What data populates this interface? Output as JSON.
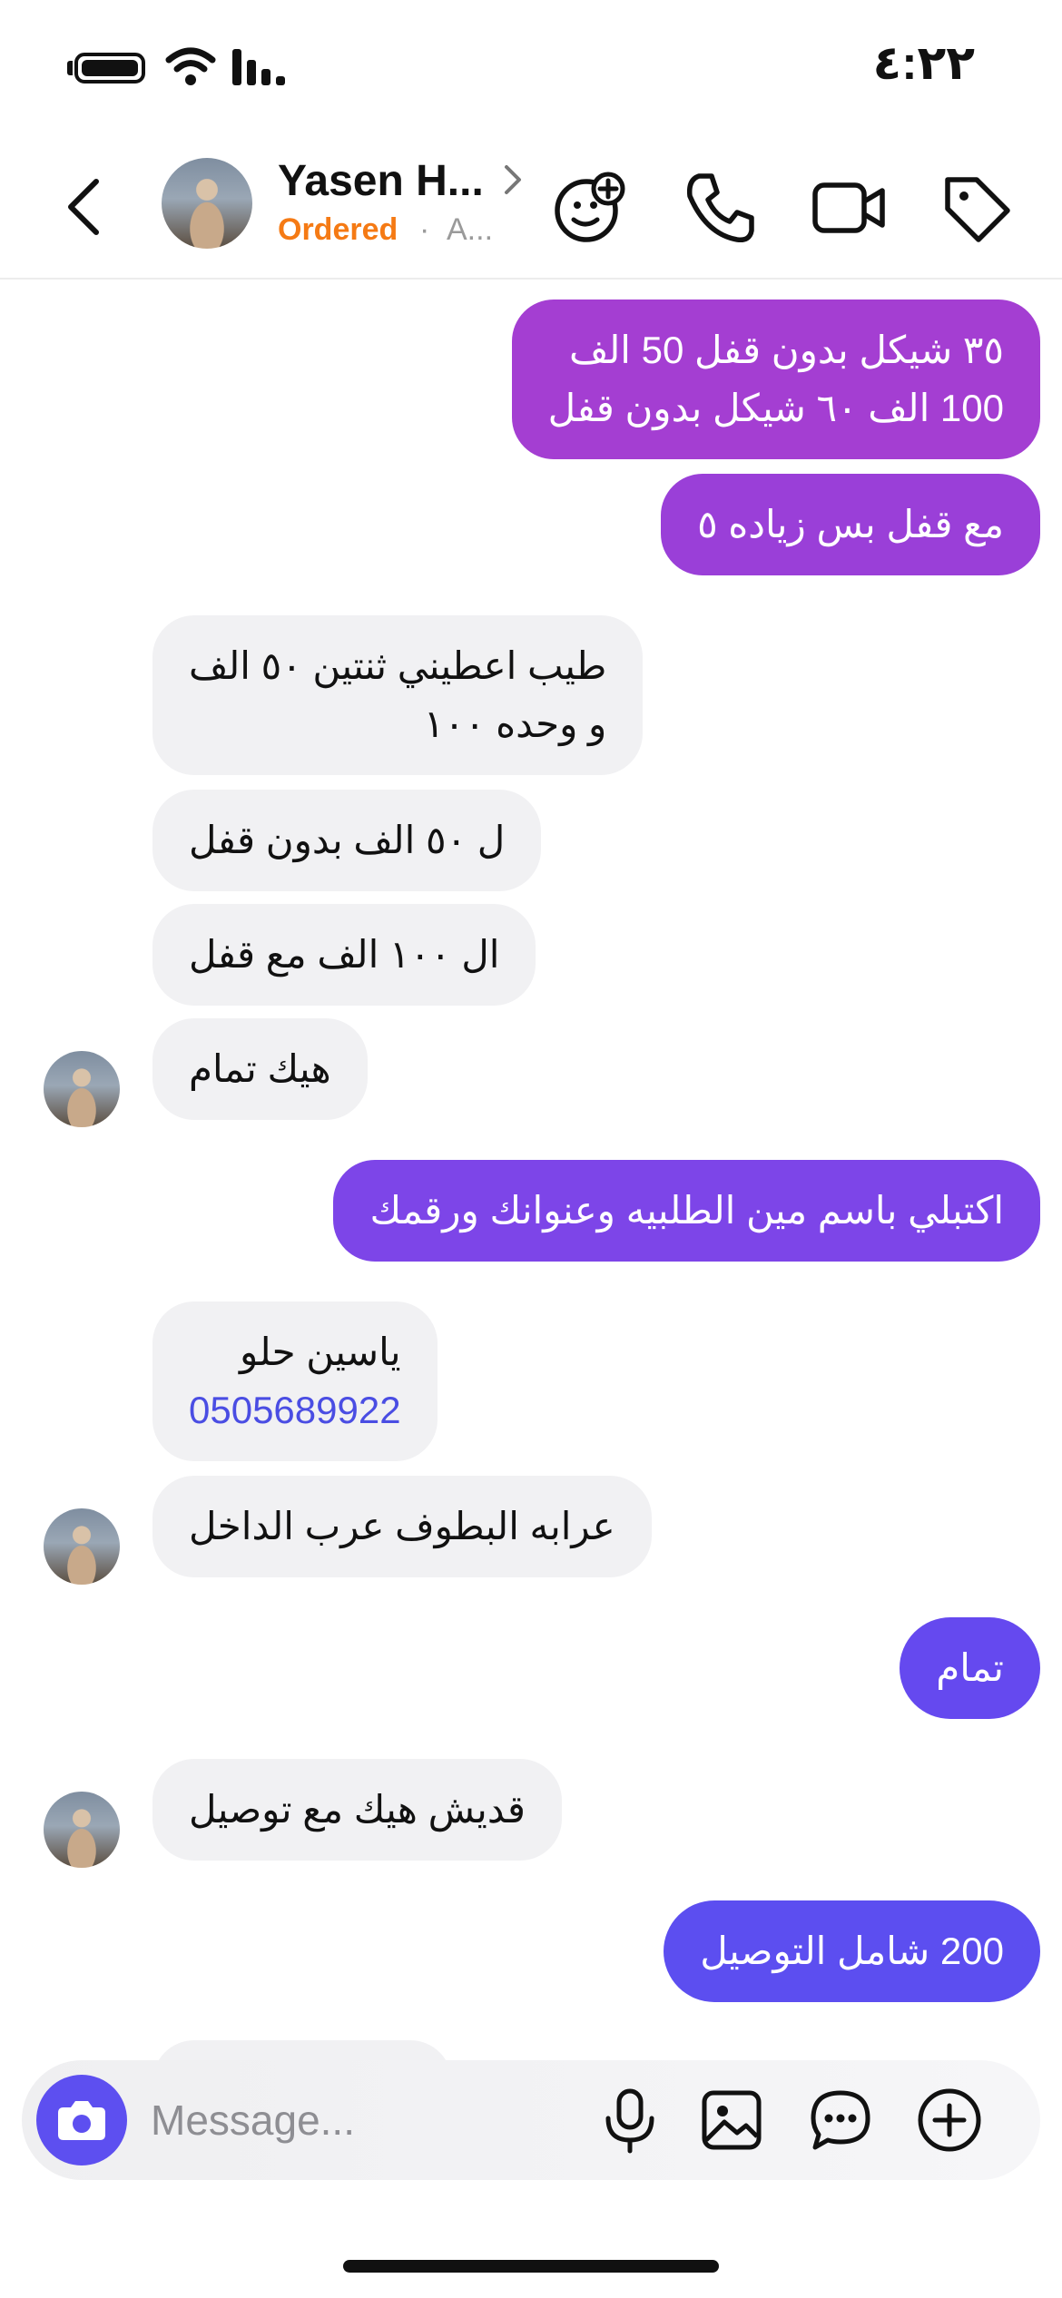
{
  "status_bar": {
    "time": "٤:٢٢"
  },
  "header": {
    "contact_name": "Yasen H...",
    "status": "Ordered",
    "separator": "·",
    "sub_text": "A..."
  },
  "messages": [
    {
      "side": "out",
      "lines": [
        "٣٥ شيكل بدون قفل 50 الف",
        "100 الف ٦٠ شيكل بدون قفل"
      ]
    },
    {
      "side": "out",
      "lines": [
        "مع قفل بس زياده ٥"
      ]
    },
    {
      "side": "in",
      "lines": [
        "طيب اعطيني ثنتين ٥٠ الف",
        "و وحده ١٠٠"
      ]
    },
    {
      "side": "in",
      "lines": [
        "ل ٥٠ الف بدون قفل"
      ]
    },
    {
      "side": "in",
      "lines": [
        "ال ١٠٠ الف مع قفل"
      ]
    },
    {
      "side": "in",
      "lines": [
        "هيك تمام"
      ]
    },
    {
      "side": "out",
      "lines": [
        "اكتبلي باسم مين الطلبيه وعنوانك ورقمك"
      ]
    },
    {
      "side": "in",
      "lines": [
        "ياسين حلو"
      ],
      "phone": "0505689922"
    },
    {
      "side": "in",
      "lines": [
        "عرابه البطوف عرب الداخل"
      ]
    },
    {
      "side": "out",
      "lines": [
        "تمام"
      ]
    },
    {
      "side": "in",
      "lines": [
        "قديش هيك مع توصيل"
      ]
    },
    {
      "side": "out",
      "lines": [
        "200 شامل التوصيل"
      ]
    }
  ],
  "composer": {
    "placeholder": "Message..."
  },
  "colors": {
    "accent": "#5d4ff0",
    "status_orange": "#f57a14",
    "incoming_bg": "#f1f1f3",
    "gradient_top": "#a63fd0",
    "gradient_bottom": "#5a4ef0"
  },
  "icons": [
    "battery-icon",
    "wifi-icon",
    "signal-icon",
    "back-icon",
    "chevron-right-icon",
    "sticker-add-icon",
    "phone-icon",
    "video-icon",
    "tag-icon",
    "camera-icon",
    "microphone-icon",
    "image-icon",
    "chat-bubble-icon",
    "plus-circle-icon"
  ]
}
